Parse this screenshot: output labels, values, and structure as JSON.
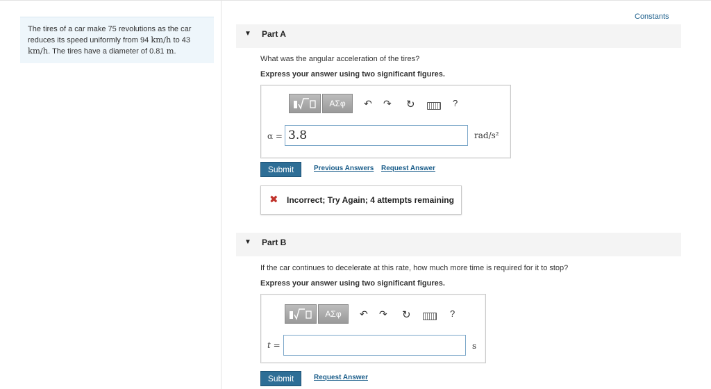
{
  "problem": {
    "text_a": "The tires of a car make 75 revolutions as the car reduces its speed uniformly from 94 ",
    "unit_1": "km/h",
    "text_b": " to 43 ",
    "unit_2": "km/h",
    "text_c": ". The tires have a diameter of 0.81 ",
    "unit_3": "m",
    "text_d": "."
  },
  "constants_label": "Constants",
  "part_a": {
    "title": "Part A",
    "question": "What was the angular acceleration of the tires?",
    "instruction": "Express your answer using two significant figures.",
    "toolbar": {
      "math_templates_icon": "math-templates-icon",
      "symbols_label": "ΑΣφ",
      "undo_icon": "↶",
      "redo_icon": "↷",
      "reset_icon": "↻",
      "help_label": "?"
    },
    "variable_label": "α =",
    "input_value": "3.8",
    "unit_label": "rad/s²",
    "submit_label": "Submit",
    "previous_answers_label": "Previous Answers",
    "request_answer_label": "Request Answer",
    "feedback_icon": "✖",
    "feedback_text": "Incorrect; Try Again; 4 attempts remaining"
  },
  "part_b": {
    "title": "Part B",
    "question": "If the car continues to decelerate at this rate, how much more time is required for it to stop?",
    "instruction": "Express your answer using two significant figures.",
    "toolbar": {
      "symbols_label": "ΑΣφ",
      "undo_icon": "↶",
      "redo_icon": "↷",
      "reset_icon": "↻",
      "help_label": "?"
    },
    "variable_label": "t =",
    "input_value": "",
    "unit_label": "s",
    "submit_label": "Submit",
    "request_answer_label": "Request Answer"
  },
  "colors": {
    "accent": "#2e6e96",
    "link": "#1a5d8a",
    "error": "#c0322b"
  }
}
